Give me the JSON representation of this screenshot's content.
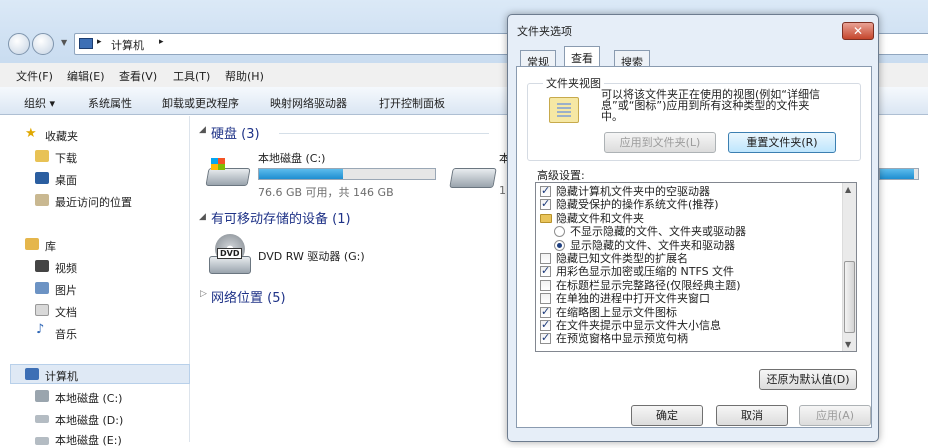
{
  "explorer": {
    "breadcrumb": [
      "计算机"
    ],
    "menu": [
      "文件(F)",
      "编辑(E)",
      "查看(V)",
      "工具(T)",
      "帮助(H)"
    ],
    "toolbar": [
      "组织 ▾",
      "系统属性",
      "卸载或更改程序",
      "映射网络驱动器",
      "打开控制面板"
    ],
    "sidebar": {
      "favorites_header": "收藏夹",
      "favorites": [
        "下载",
        "桌面",
        "最近访问的位置"
      ],
      "library_header": "库",
      "libraries": [
        "视频",
        "图片",
        "文档",
        "音乐"
      ],
      "computer_header": "计算机",
      "drives": [
        "本地磁盘 (C:)",
        "本地磁盘 (D:)",
        "本地磁盘 (E:)"
      ]
    },
    "groups": {
      "hard_disks": "硬盘 (3)",
      "removable": "有可移动存储的设备 (1)",
      "network": "网络位置 (5)"
    },
    "drive_c": {
      "name": "本地磁盘 (C:)",
      "info": "76.6 GB 可用，共 146 GB",
      "used_fraction": 0.48
    },
    "drive_d": {
      "name": "本",
      "info": "1",
      "used_fraction": 0.9
    },
    "dvd": {
      "name": "DVD RW 驱动器 (G:)",
      "badge": "DVD"
    }
  },
  "dialog": {
    "title": "文件夹选项",
    "close": "✕",
    "tabs": [
      "常规",
      "查看",
      "搜索"
    ],
    "folder_views": {
      "legend": "文件夹视图",
      "desc_lines": [
        "可以将该文件夹正在使用的视图(例如“详细信",
        "息”或“图标”)应用到所有这种类型的文件夹",
        "中。"
      ],
      "apply_btn": "应用到文件夹(L)",
      "reset_btn": "重置文件夹(R)"
    },
    "advanced_label": "高级设置:",
    "items": [
      {
        "type": "check",
        "checked": true,
        "indent": 0,
        "label": "隐藏计算机文件夹中的空驱动器"
      },
      {
        "type": "check",
        "checked": true,
        "indent": 0,
        "label": "隐藏受保护的操作系统文件(推荐)"
      },
      {
        "type": "folder",
        "indent": 0,
        "label": "隐藏文件和文件夹"
      },
      {
        "type": "radio",
        "checked": false,
        "indent": 1,
        "label": "不显示隐藏的文件、文件夹或驱动器"
      },
      {
        "type": "radio",
        "checked": true,
        "indent": 1,
        "label": "显示隐藏的文件、文件夹和驱动器"
      },
      {
        "type": "check",
        "checked": false,
        "indent": 0,
        "label": "隐藏已知文件类型的扩展名"
      },
      {
        "type": "check",
        "checked": true,
        "indent": 0,
        "label": "用彩色显示加密或压缩的 NTFS 文件"
      },
      {
        "type": "check",
        "checked": false,
        "indent": 0,
        "label": "在标题栏显示完整路径(仅限经典主题)"
      },
      {
        "type": "check",
        "checked": false,
        "indent": 0,
        "label": "在单独的进程中打开文件夹窗口"
      },
      {
        "type": "check",
        "checked": true,
        "indent": 0,
        "label": "在缩略图上显示文件图标"
      },
      {
        "type": "check",
        "checked": true,
        "indent": 0,
        "label": "在文件夹提示中显示文件大小信息"
      },
      {
        "type": "check",
        "checked": true,
        "indent": 0,
        "label": "在预览窗格中显示预览句柄"
      }
    ],
    "restore_btn": "还原为默认值(D)",
    "ok_btn": "确定",
    "cancel_btn": "取消",
    "apply_btn": "应用(A)"
  }
}
